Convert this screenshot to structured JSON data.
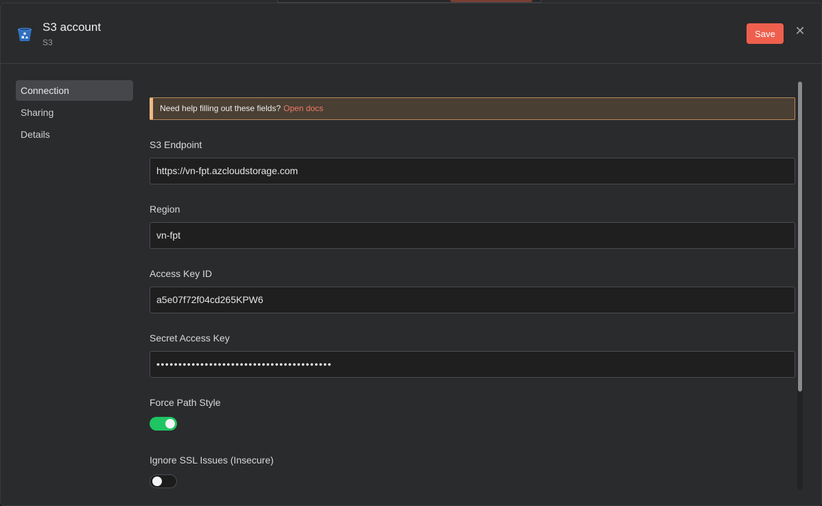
{
  "header": {
    "title": "S3 account",
    "subtitle": "S3",
    "save_label": "Save",
    "close_glyph": "✕",
    "icon": "s3-bucket-icon"
  },
  "sidebar": {
    "items": [
      {
        "label": "Connection",
        "active": true
      },
      {
        "label": "Sharing",
        "active": false
      },
      {
        "label": "Details",
        "active": false
      }
    ]
  },
  "notice": {
    "text": "Need help filling out these fields?",
    "link": "Open docs"
  },
  "fields": {
    "endpoint": {
      "label": "S3 Endpoint",
      "value": "https://vn-fpt.azcloudstorage.com"
    },
    "region": {
      "label": "Region",
      "value": "vn-fpt"
    },
    "access_key_id": {
      "label": "Access Key ID",
      "value": "a5e07f72f04cd265KPW6"
    },
    "secret_access_key": {
      "label": "Secret Access Key",
      "value": "••••••••••••••••••••••••••••••••••••••••"
    },
    "force_path_style": {
      "label": "Force Path Style",
      "enabled": true
    },
    "ignore_ssl": {
      "label": "Ignore SSL Issues (Insecure)",
      "enabled": false
    }
  },
  "colors": {
    "accent": "#ef5f4e",
    "toggle_on": "#1fc562",
    "notice_border": "#f0ba84",
    "link": "#f07a68"
  }
}
